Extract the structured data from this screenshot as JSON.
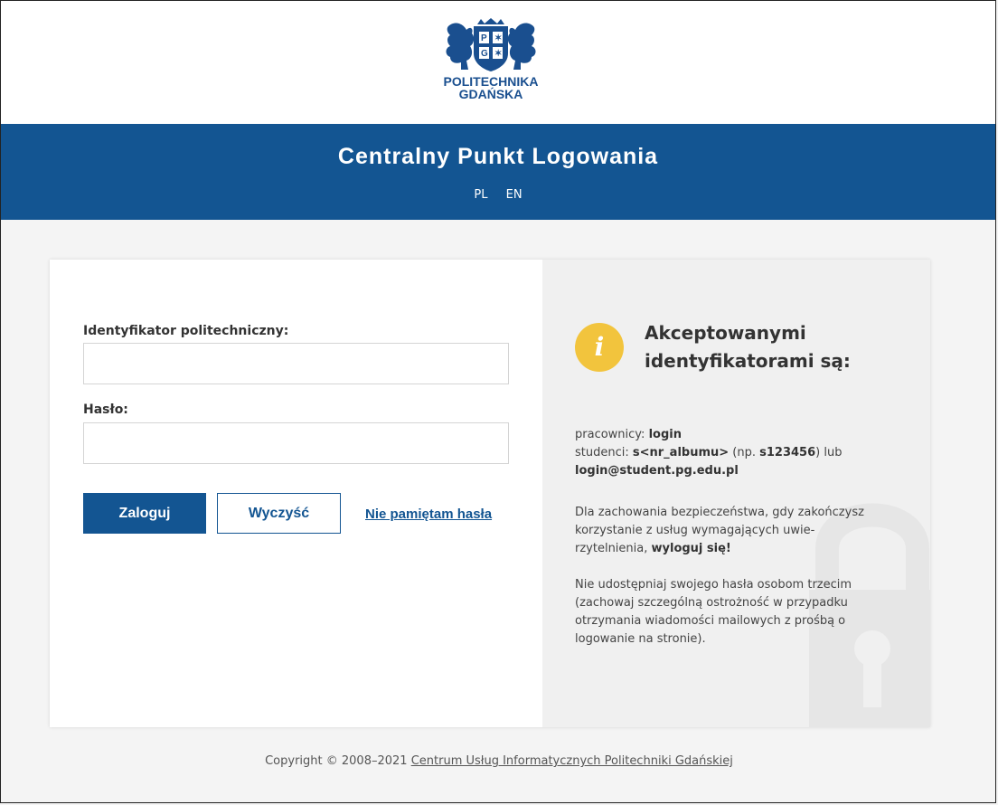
{
  "logo": {
    "line1": "POLITECHNIKA",
    "line2": "GDAŃSKA"
  },
  "banner": {
    "title": "Centralny Punkt Logowania"
  },
  "lang": {
    "pl": "PL",
    "en": "EN"
  },
  "form": {
    "id_label": "Identyfikator politechniczny:",
    "id_value": "",
    "password_label": "Hasło:",
    "password_value": "",
    "login_button": "Zaloguj",
    "clear_button": "Wyczyść",
    "forgot_link": "Nie pamiętam hasła"
  },
  "info": {
    "icon_glyph": "i",
    "title": "Akceptowanymi identyfikatorami są:",
    "employees_prefix": "pracownicy: ",
    "employees_value": "login",
    "students_prefix": "studenci: ",
    "students_value": "s<nr_albumu>",
    "students_example_prefix": " (np. ",
    "students_example": "s123456",
    "students_example_suffix": ") lub",
    "students_email": "login@student.pg.edu.pl",
    "security_text": "Dla zachowania bezpieczeństwa, gdy zakoń­czysz korzystanie z usług wymagających uwie­rzytelnienia, ",
    "security_emphasis": "wyloguj się!",
    "warning_text": "Nie udostępniaj swojego hasła osobom trzecim (zachowaj szczególną ostrożność w przypadku otrzymania wiadomości mailowych z prośbą o logowanie na stronie)."
  },
  "footer": {
    "copyright": "Copyright © 2008–2021 ",
    "link": "Centrum Usług Informatycznych Politechniki Gdańskiej"
  },
  "colors": {
    "primary": "#135592",
    "info_icon": "#f2c43d"
  }
}
